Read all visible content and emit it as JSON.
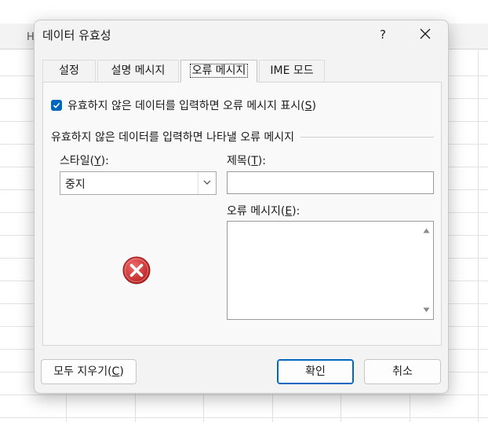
{
  "background": {
    "column_header_fragment": "H"
  },
  "dialog": {
    "title": "데이터 유효성",
    "help_label": "?",
    "tabs": [
      {
        "label": "설정",
        "active": false
      },
      {
        "label": "설명 메시지",
        "active": false
      },
      {
        "label": "오류 메시지",
        "active": true
      },
      {
        "label": "IME 모드",
        "active": false
      }
    ],
    "show_error_checkbox": {
      "checked": true,
      "label_prefix": "유효하지 않은 데이터를 입력하면 오류 메시지 표시(",
      "mnemonic": "S",
      "label_suffix": ")"
    },
    "group_label": "유효하지 않은 데이터를 입력하면 나타낼 오류 메시지",
    "style": {
      "label_prefix": "스타일(",
      "mnemonic": "Y",
      "label_suffix": "):",
      "value": "중지"
    },
    "title_field": {
      "label_prefix": "제목(",
      "mnemonic": "T",
      "label_suffix": "):",
      "value": ""
    },
    "error_message_field": {
      "label_prefix": "오류 메시지(",
      "mnemonic": "E",
      "label_suffix": "):",
      "value": ""
    },
    "buttons": {
      "clear_all_prefix": "모두 지우기(",
      "clear_all_mnemonic": "C",
      "clear_all_suffix": ")",
      "ok": "확인",
      "cancel": "취소"
    }
  },
  "colors": {
    "accent": "#0067c0",
    "error_icon": "#c62828"
  }
}
